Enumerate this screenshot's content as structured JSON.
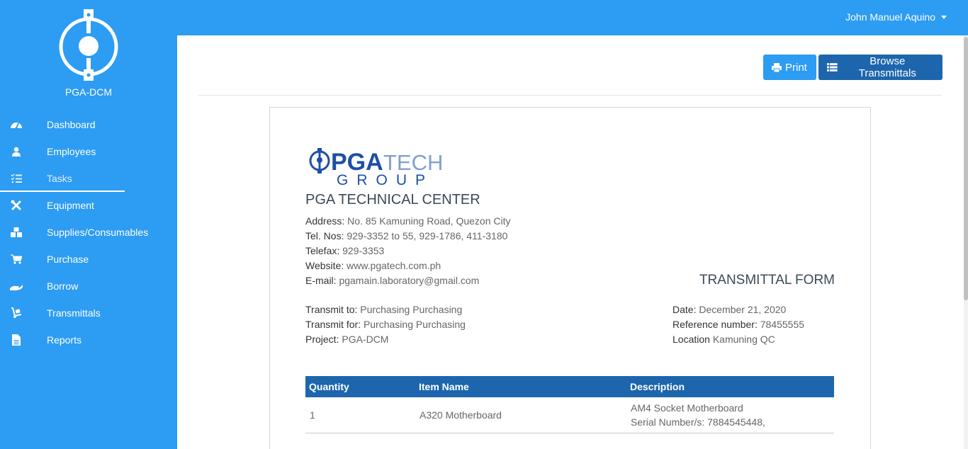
{
  "user": {
    "name": "John Manuel Aquino"
  },
  "brand": {
    "name": "PGA-DCM"
  },
  "sidebar": {
    "items": [
      {
        "label": "Dashboard",
        "icon": "dashboard-icon"
      },
      {
        "label": "Employees",
        "icon": "user-icon"
      },
      {
        "label": "Tasks",
        "icon": "tasks-icon",
        "active": true
      },
      {
        "label": "Equipment",
        "icon": "tools-icon"
      },
      {
        "label": "Supplies/Consumables",
        "icon": "boxes-icon"
      },
      {
        "label": "Purchase",
        "icon": "cart-icon"
      },
      {
        "label": "Borrow",
        "icon": "hand-icon"
      },
      {
        "label": "Transmittals",
        "icon": "dolly-icon"
      },
      {
        "label": "Reports",
        "icon": "file-icon"
      }
    ]
  },
  "toolbar": {
    "print_label": "Print",
    "browse_label": "Browse Transmittals"
  },
  "document": {
    "logo": {
      "line1_bold": "PGA",
      "line1_light": "TECH",
      "line2": "GROUP"
    },
    "company_name": "PGA TECHNICAL CENTER",
    "address": {
      "label": "Address:",
      "value": "No. 85 Kamuning Road, Quezon City"
    },
    "tel": {
      "label": "Tel. Nos:",
      "value": "929-3352 to 55, 929-1786, 411-3180"
    },
    "telefax": {
      "label": "Telefax:",
      "value": "929-3353"
    },
    "website": {
      "label": "Website:",
      "value": "www.pgatech.com.ph"
    },
    "email": {
      "label": "E-mail:",
      "value": "pgamain.laboratory@gmail.com"
    },
    "form_title": "TRANSMITTAL FORM",
    "transmit_to": {
      "label": "Transmit to:",
      "value": "Purchasing Purchasing"
    },
    "transmit_for": {
      "label": "Transmit for:",
      "value": "Purchasing Purchasing"
    },
    "project": {
      "label": "Project:",
      "value": "PGA-DCM"
    },
    "date": {
      "label": "Date:",
      "value": "December 21, 2020"
    },
    "reference": {
      "label": "Reference number:",
      "value": "78455555"
    },
    "location": {
      "label": "Location",
      "value": "Kamuning QC"
    },
    "table": {
      "headers": [
        "Quantity",
        "Item Name",
        "Description"
      ],
      "rows": [
        {
          "quantity": "1",
          "item_name": "A320 Motherboard",
          "desc_line1": "AM4 Socket Motherboard",
          "desc_line2": "Serial Number/s: 7884545448,"
        }
      ]
    }
  },
  "colors": {
    "primary": "#2d9cf3",
    "dark_primary": "#1d66ad"
  }
}
